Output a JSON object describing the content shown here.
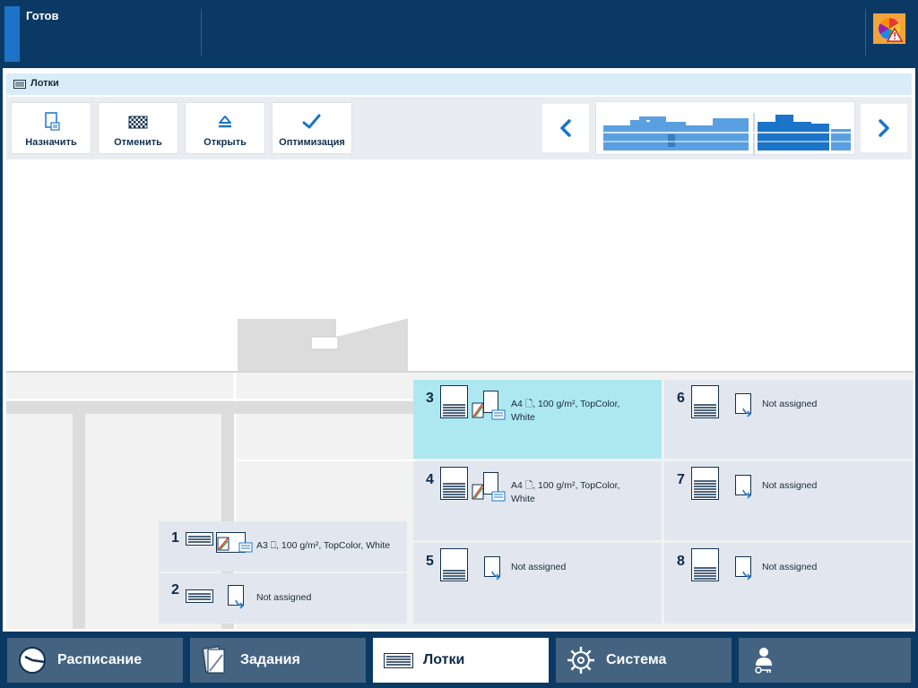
{
  "status": {
    "text": "Готов"
  },
  "section": {
    "title": "Лотки"
  },
  "toolbar": {
    "assign_label": "Назначить",
    "cancel_label": "Отменить",
    "open_label": "Открыть",
    "optimize_label": "Оптимизация"
  },
  "trays": [
    {
      "number": "1",
      "info": "A3 ⎕, 100 g/m², TopColor, White",
      "selected": false
    },
    {
      "number": "2",
      "info": "Not assigned",
      "selected": false
    },
    {
      "number": "3",
      "info": "A4 🗋, 100 g/m², TopColor, White",
      "selected": true
    },
    {
      "number": "4",
      "info": "A4 🗋, 100 g/m², TopColor, White",
      "selected": false
    },
    {
      "number": "5",
      "info": "Not assigned",
      "selected": false
    },
    {
      "number": "6",
      "info": "Not assigned",
      "selected": false
    },
    {
      "number": "7",
      "info": "Not assigned",
      "selected": false
    },
    {
      "number": "8",
      "info": "Not assigned",
      "selected": false
    }
  ],
  "nav": {
    "schedule_label": "Расписание",
    "jobs_label": "Задания",
    "trays_label": "Лотки",
    "system_label": "Система"
  },
  "colors": {
    "accent": "#1b74c7",
    "header_bg": "#0a3a64",
    "selected_tray": "#ade8f1"
  }
}
